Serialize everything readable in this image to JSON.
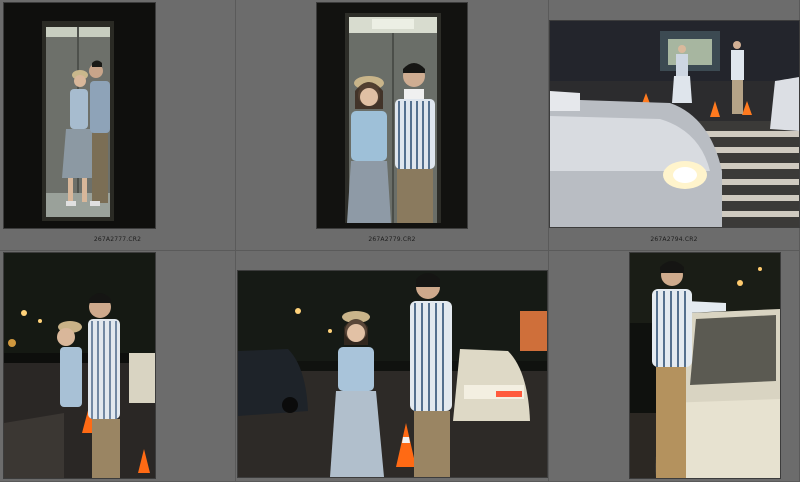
{
  "grid": {
    "items": [
      {
        "filename": "267A2777.CR2",
        "subject": "couple embracing in elevator"
      },
      {
        "filename": "267A2779.CR2",
        "subject": "couple standing in elevator"
      },
      {
        "filename": "267A2794.CR2",
        "subject": "couple at crosswalk with passing car"
      },
      {
        "filename": "",
        "subject": "couple on night street with traffic cones"
      },
      {
        "filename": "",
        "subject": "woman facing man near white car"
      },
      {
        "filename": "",
        "subject": "man leaning on white car"
      }
    ]
  },
  "colors": {
    "background": "#6b6b6b",
    "cell_border": "#5a5a5a",
    "filename_text": "#1e1e1e"
  }
}
